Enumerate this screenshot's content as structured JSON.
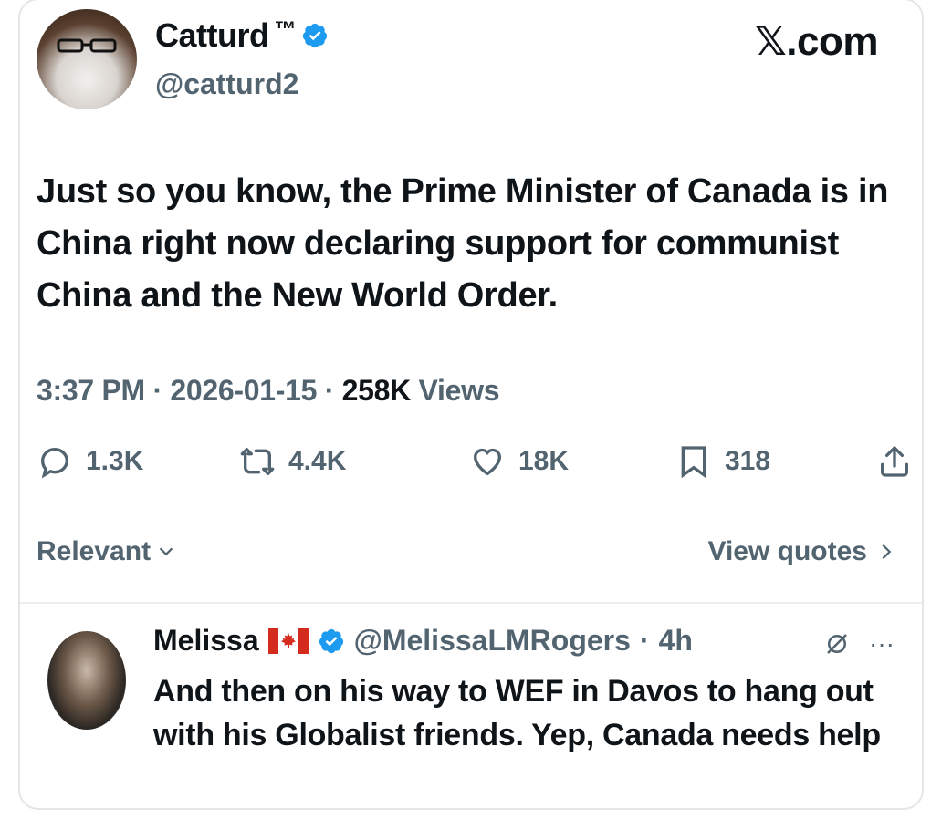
{
  "tweet": {
    "author_name": "Catturd",
    "author_tm": "™",
    "author_handle": "@catturd2",
    "watermark": "𝕏.com",
    "text": "Just so you know, the Prime Minister of Canada is in China right now declaring support for communist China and the New World Order.",
    "time": "3:37 PM",
    "date": "2026-01-15",
    "views_count": "258K",
    "views_label": "Views",
    "separator": "·"
  },
  "actions": {
    "replies": "1.3K",
    "reposts": "4.4K",
    "likes": "18K",
    "bookmarks": "318"
  },
  "footer": {
    "relevant_label": "Relevant",
    "view_quotes_label": "View quotes"
  },
  "reply": {
    "author_name": "Melissa",
    "author_handle": "@MelissaLMRogers",
    "age": "4h",
    "separator": "·",
    "text": "And then on his way to WEF in Davos to hang out with his Globalist friends. Yep, Canada needs help",
    "more_icon": "···"
  },
  "colors": {
    "verified": "#1d9bf0",
    "secondary_text": "#536471",
    "primary_text": "#0f1419",
    "flag_red": "#d52b1e"
  }
}
